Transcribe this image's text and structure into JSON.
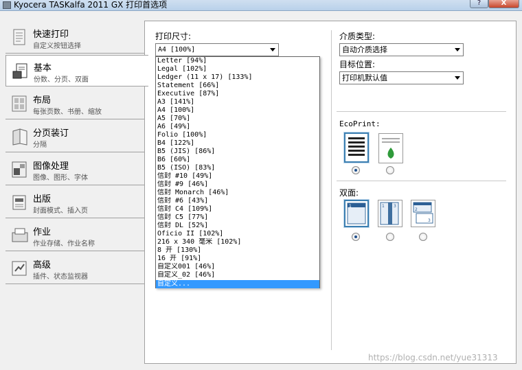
{
  "window": {
    "title": "Kyocera TASKalfa 2011 GX 打印首选项",
    "help_label": "?",
    "close_label": "X"
  },
  "sidebar": {
    "items": [
      {
        "label": "快速打印",
        "sub": "自定义按钮选择"
      },
      {
        "label": "基本",
        "sub": "份数、分页、双面"
      },
      {
        "label": "布局",
        "sub": "每张页数、书册、缩放"
      },
      {
        "label": "分页装订",
        "sub": "分隔"
      },
      {
        "label": "图像处理",
        "sub": "图像、图形、字体"
      },
      {
        "label": "出版",
        "sub": "封面模式、插入页"
      },
      {
        "label": "作业",
        "sub": "作业存储、作业名称"
      },
      {
        "label": "高级",
        "sub": "插件、状态监视器"
      }
    ]
  },
  "basic": {
    "print_size_label": "打印尺寸:",
    "print_size_value": "A4  [100%]",
    "media_type_label": "介质类型:",
    "media_type_value": "自动介质选择",
    "destination_label": "目标位置:",
    "destination_value": "打印机默认值",
    "ecoprint_label": "EcoPrint:",
    "duplex_label": "双面:",
    "ecoprint_selected": 0,
    "duplex_selected": 0
  },
  "print_size_options": [
    "Letter  [94%]",
    "Legal  [102%]",
    "Ledger (11 x 17)  [133%]",
    "Statement  [66%]",
    "Executive  [87%]",
    "A3  [141%]",
    "A4  [100%]",
    "A5  [70%]",
    "A6  [49%]",
    "Folio  [100%]",
    "B4  [122%]",
    "B5 (JIS)  [86%]",
    "B6  [60%]",
    "B5 (ISO)  [83%]",
    "信封 #10  [49%]",
    "信封 #9  [46%]",
    "信封 Monarch  [46%]",
    "信封 #6  [43%]",
    "信封 C4  [109%]",
    "信封 C5  [77%]",
    "信封 DL  [52%]",
    "Oficio II  [102%]",
    "216 x 340 毫米  [102%]",
    "8 开  [130%]",
    "16 开  [91%]",
    "自定义001 [46%]",
    "自定义_02 [46%]",
    "自定义..."
  ],
  "watermark": "https://blog.csdn.net/yue31313",
  "colors": {
    "selection": "#3399ff",
    "titlebar": "#b9d1ea",
    "close": "#c7462b"
  }
}
